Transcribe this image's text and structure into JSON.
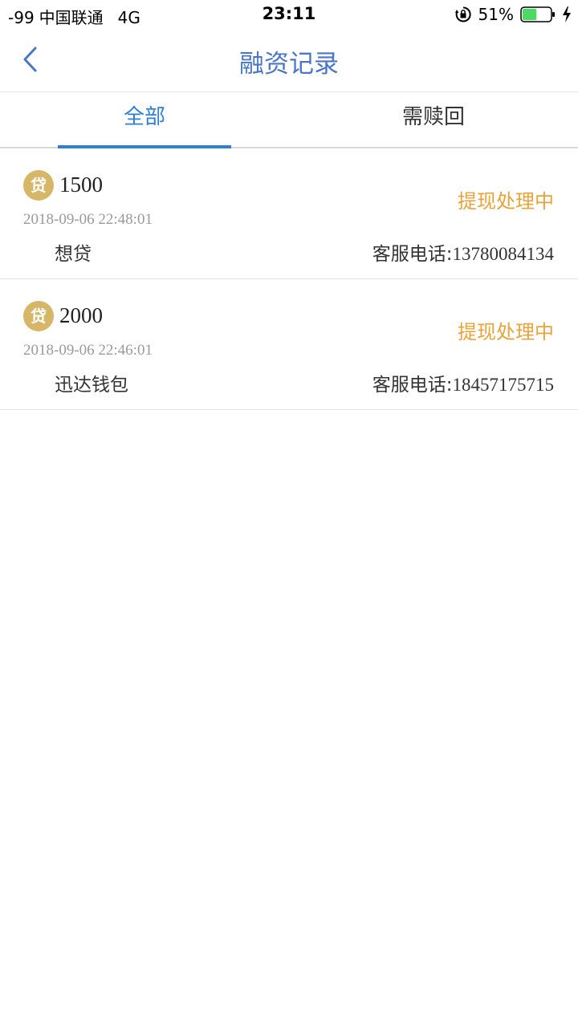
{
  "status_bar": {
    "signal": "-99",
    "carrier": "中国联通",
    "network": "4G",
    "time": "23:11",
    "battery_percent": "51%",
    "battery_level": 0.51,
    "icons": [
      "rotation-lock-icon",
      "battery-icon",
      "charging-bolt-icon"
    ]
  },
  "nav": {
    "title": "融资记录",
    "back_icon": "chevron-left-icon"
  },
  "tabs": [
    {
      "label": "全部",
      "active": true
    },
    {
      "label": "需赎回",
      "active": false
    }
  ],
  "records": [
    {
      "badge": "贷",
      "amount": "1500",
      "date": "2018-09-06 22:48:01",
      "status": "提现处理中",
      "lender": "想贷",
      "phone_label": "客服电话:",
      "phone": "13780084134"
    },
    {
      "badge": "贷",
      "amount": "2000",
      "date": "2018-09-06 22:46:01",
      "status": "提现处理中",
      "lender": "迅达钱包",
      "phone_label": "客服电话:",
      "phone": "18457175715"
    }
  ],
  "colors": {
    "accent": "#2f7fd6",
    "title": "#4a76c8",
    "status": "#e8a33a",
    "badge": "#d6b767",
    "battery": "#4cd964"
  }
}
